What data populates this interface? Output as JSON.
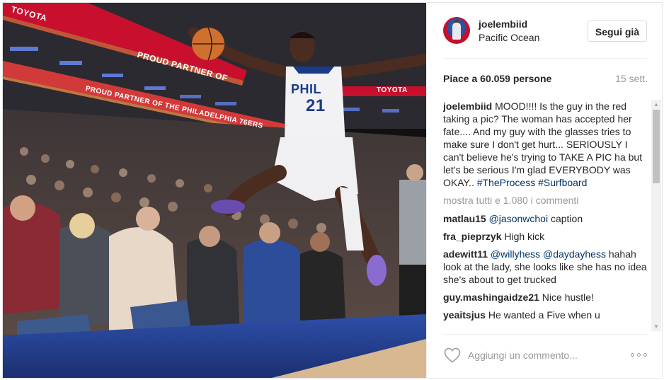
{
  "photo": {
    "ad_board_top": "TOYOTA",
    "ad_board_mid": "PROUD PARTNER OF",
    "ad_board_lower": "PROUD PARTNER OF THE PHILADELPHIA 76ERS",
    "ad_board_lower_right": "TOYOTA",
    "jersey_team": "PHIL",
    "jersey_number": "21"
  },
  "header": {
    "username": "joelembiid",
    "location": "Pacific Ocean",
    "follow_label": "Segui già"
  },
  "stats": {
    "likes": "Piace a 60.059 persone",
    "date": "15 sett."
  },
  "caption": {
    "user": "joelembiid",
    "text": "MOOD!!!! Is the guy in the red taking a pic? The woman has accepted her fate.... And my guy with the glasses tries to make sure I don't get hurt... SERIOUSLY I can't believe he's trying to TAKE A PIC ha but let's be serious I'm glad EVERYBODY was OKAY..",
    "tag1": "#TheProcess",
    "tag2": "#Surfboard"
  },
  "view_all": "mostra tutti e 1.080 i commenti",
  "comments": [
    {
      "user": "matlau15",
      "mention": "@jasonwchoi",
      "text": "caption"
    },
    {
      "user": "fra_pieprzyk",
      "mention": "",
      "text": "High kick"
    },
    {
      "user": "adewitt11",
      "mention": "@willyhess @daydayhess",
      "text": "hahah look at the lady, she looks like she has no idea she's about to get trucked"
    },
    {
      "user": "guy.mashingaidze21",
      "mention": "",
      "text": "Nice hustle!"
    },
    {
      "user": "yeaitsjus",
      "mention": "",
      "text": "He wanted a Five when u"
    }
  ],
  "footer": {
    "comment_placeholder": "Aggiungi un commento..."
  },
  "icons": {
    "heart": "heart-icon",
    "more": "more-options-icon",
    "scroll_up": "scroll-up-arrow",
    "scroll_down": "scroll-down-arrow"
  },
  "colors": {
    "link": "#003569",
    "muted": "#999999",
    "text": "#262626",
    "border": "#dbdbdb"
  }
}
